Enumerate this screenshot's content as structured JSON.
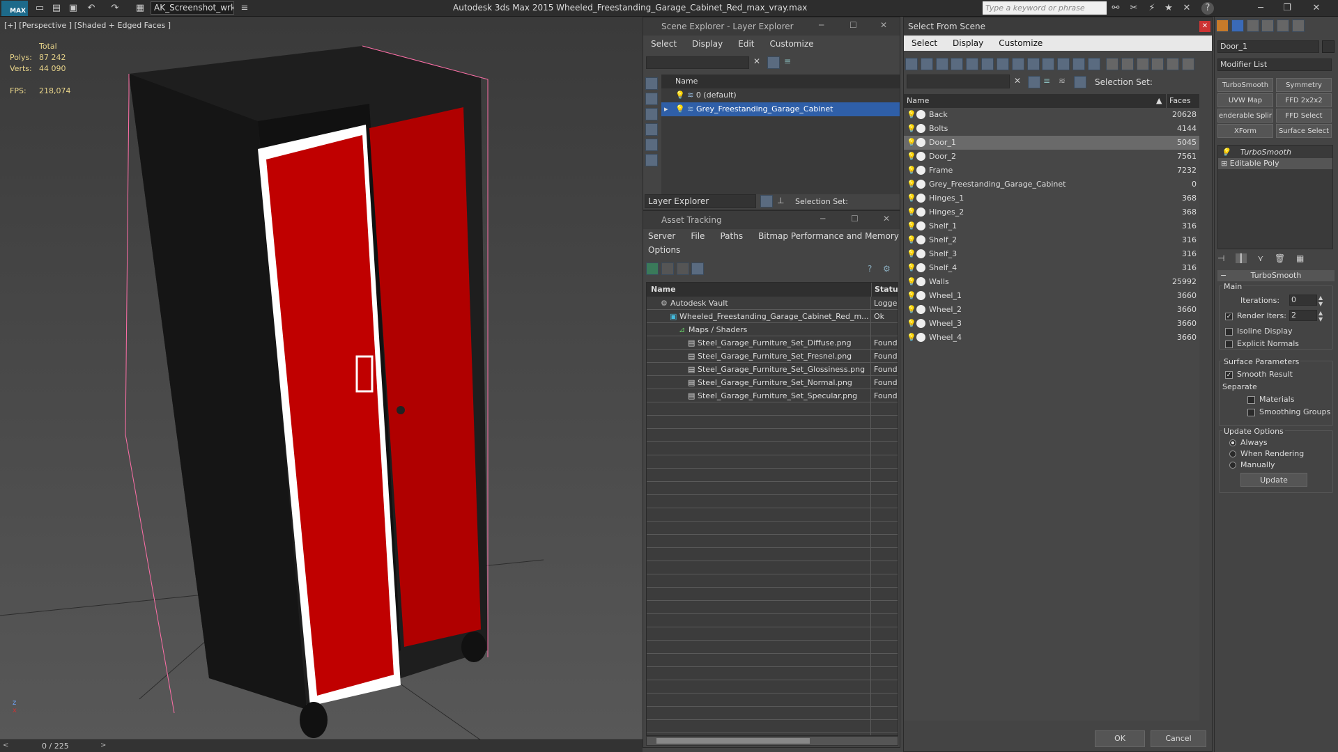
{
  "app": {
    "title": "Autodesk 3ds Max  2015    Wheeled_Freestanding_Garage_Cabinet_Red_max_vray.max",
    "workspace": "AK_Screenshot_wrksp",
    "search_placeholder": "Type a keyword or phrase",
    "logo": "MAX"
  },
  "viewport": {
    "label": "[+] [Perspective ] [Shaded + Edged Faces ]",
    "stats": {
      "total_label": "Total",
      "polys_label": "Polys:",
      "polys": "87 242",
      "verts_label": "Verts:",
      "verts": "44 090",
      "fps_label": "FPS:",
      "fps": "218,074"
    },
    "timeline": "0 / 225"
  },
  "scene_explorer": {
    "title": "Scene Explorer - Layer Explorer",
    "menu": [
      "Select",
      "Display",
      "Edit",
      "Customize"
    ],
    "col_name": "Name",
    "layers": [
      "0 (default)",
      "Grey_Freestanding_Garage_Cabinet"
    ],
    "footer_mode": "Layer Explorer",
    "selection_set": "Selection Set:"
  },
  "asset_tracking": {
    "title": "Asset Tracking",
    "menu": [
      "Server",
      "File",
      "Paths",
      "Bitmap Performance and Memory"
    ],
    "menu2": "Options",
    "col_name": "Name",
    "col_status": "Status",
    "rows": [
      {
        "name": "Autodesk Vault",
        "status": "Logged",
        "indent": 0
      },
      {
        "name": "Wheeled_Freestanding_Garage_Cabinet_Red_m...",
        "status": "Ok",
        "indent": 1
      },
      {
        "name": "Maps / Shaders",
        "status": "",
        "indent": 2
      },
      {
        "name": "Steel_Garage_Furniture_Set_Diffuse.png",
        "status": "Found",
        "indent": 3
      },
      {
        "name": "Steel_Garage_Furniture_Set_Fresnel.png",
        "status": "Found",
        "indent": 3
      },
      {
        "name": "Steel_Garage_Furniture_Set_Glossiness.png",
        "status": "Found",
        "indent": 3
      },
      {
        "name": "Steel_Garage_Furniture_Set_Normal.png",
        "status": "Found",
        "indent": 3
      },
      {
        "name": "Steel_Garage_Furniture_Set_Specular.png",
        "status": "Found",
        "indent": 3
      }
    ]
  },
  "select_from_scene": {
    "title": "Select From Scene",
    "menu": [
      "Select",
      "Display",
      "Customize"
    ],
    "selection_set": "Selection Set:",
    "col_name": "Name",
    "col_faces": "Faces",
    "rows": [
      {
        "name": "Back",
        "faces": "20628"
      },
      {
        "name": "Bolts",
        "faces": "4144"
      },
      {
        "name": "Door_1",
        "faces": "5045",
        "selected": true
      },
      {
        "name": "Door_2",
        "faces": "7561"
      },
      {
        "name": "Frame",
        "faces": "7232"
      },
      {
        "name": "Grey_Freestanding_Garage_Cabinet",
        "faces": "0"
      },
      {
        "name": "Hinges_1",
        "faces": "368"
      },
      {
        "name": "Hinges_2",
        "faces": "368"
      },
      {
        "name": "Shelf_1",
        "faces": "316"
      },
      {
        "name": "Shelf_2",
        "faces": "316"
      },
      {
        "name": "Shelf_3",
        "faces": "316"
      },
      {
        "name": "Shelf_4",
        "faces": "316"
      },
      {
        "name": "Walls",
        "faces": "25992"
      },
      {
        "name": "Wheel_1",
        "faces": "3660"
      },
      {
        "name": "Wheel_2",
        "faces": "3660"
      },
      {
        "name": "Wheel_3",
        "faces": "3660"
      },
      {
        "name": "Wheel_4",
        "faces": "3660"
      }
    ],
    "ok": "OK",
    "cancel": "Cancel"
  },
  "command_panel": {
    "object_name": "Door_1",
    "modifier_list": "Modifier List",
    "buttons": [
      "TurboSmooth",
      "Symmetry",
      "UVW Map",
      "FFD 2x2x2",
      "enderable Splir",
      "FFD Select",
      "XForm",
      "Surface Select"
    ],
    "stack": [
      "TurboSmooth",
      "Editable Poly"
    ],
    "rollout": "TurboSmooth",
    "main": "Main",
    "iterations_label": "Iterations:",
    "iterations": "0",
    "render_iters_label": "Render Iters:",
    "render_iters": "2",
    "isoline": "Isoline Display",
    "explicit": "Explicit Normals",
    "surface_params": "Surface Parameters",
    "smooth_result": "Smooth Result",
    "separate": "Separate",
    "materials": "Materials",
    "smoothing_groups": "Smoothing Groups",
    "update_options": "Update Options",
    "always": "Always",
    "when_rendering": "When Rendering",
    "manually": "Manually",
    "update": "Update"
  }
}
